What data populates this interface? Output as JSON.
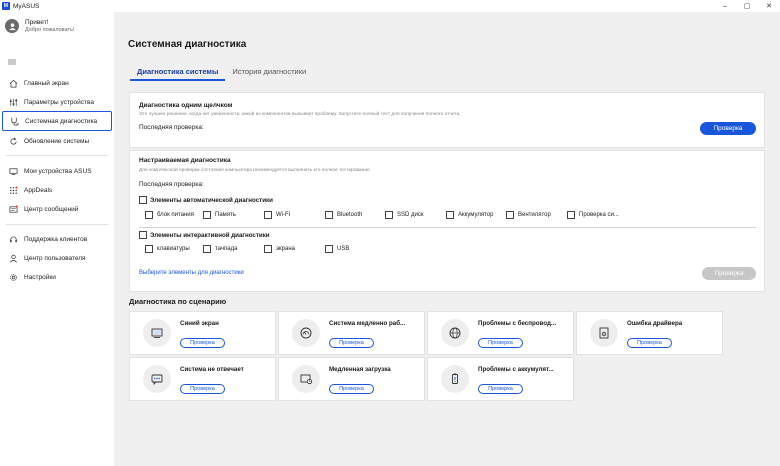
{
  "window": {
    "title": "MyASUS",
    "logo_text": "M",
    "minimize": "–",
    "maximize": "▢",
    "close": "✕"
  },
  "sidebar": {
    "greeting": "Привет!",
    "welcome": "Добро пожаловать!",
    "items": [
      {
        "label": "Главный экран",
        "icon": "home-icon"
      },
      {
        "label": "Параметры устройства",
        "icon": "settings-sliders-icon"
      },
      {
        "label": "Системная диагностика",
        "icon": "stethoscope-icon"
      },
      {
        "label": "Обновление системы",
        "icon": "refresh-icon"
      },
      {
        "label": "Мои устройства ASUS",
        "icon": "devices-icon"
      },
      {
        "label": "AppDeals",
        "icon": "grid-icon"
      },
      {
        "label": "Центр сообщений",
        "icon": "message-icon"
      },
      {
        "label": "Поддержка клиентов",
        "icon": "headset-icon"
      },
      {
        "label": "Центр пользователя",
        "icon": "user-icon"
      },
      {
        "label": "Настройки",
        "icon": "gear-icon"
      }
    ]
  },
  "main": {
    "title": "Системная диагностика",
    "tabs": [
      "Диагностика системы",
      "История диагностики"
    ]
  },
  "one_click": {
    "title": "Диагностика одним щелчком",
    "desc": "Это лучшее решение, когда нет уверенности, какой из компонентов вызывает проблему. Запустите полный тест для получения полного отчета.",
    "last_check": "Последняя проверка:",
    "button": "Проверка"
  },
  "custom": {
    "title": "Настраиваемая диагностика",
    "desc": "Для комплексной проверки состояния компьютера рекомендуется выполнить его полное тестирование.",
    "last_check": "Последняя проверка:",
    "auto_label": "Элементы автоматической диагностики",
    "auto_items": [
      "блок питания",
      "Память",
      "Wi-Fi",
      "Bluetooth",
      "SSD диск",
      "Аккумулятор",
      "Вентилятор",
      "Проверка си..."
    ],
    "interactive_label": "Элементы интерактивной диагностики",
    "interactive_items": [
      "клавиатуры",
      "тачпада",
      "экрана",
      "USB"
    ],
    "link": "Выберите элементы для диагностики",
    "button": "Проверка"
  },
  "scenarios": {
    "title": "Диагностика по сценарию",
    "button": "Проверка",
    "items": [
      {
        "name": "Синий экран",
        "icon": "monitor-icon"
      },
      {
        "name": "Система медленно раб...",
        "icon": "speedometer-icon"
      },
      {
        "name": "Проблемы с беспровод...",
        "icon": "globe-icon"
      },
      {
        "name": "Ошибка драйвера",
        "icon": "driver-gear-icon"
      },
      {
        "name": "Система не отвечает",
        "icon": "chat-dots-icon"
      },
      {
        "name": "Медленная загрузка",
        "icon": "screen-clock-icon"
      },
      {
        "name": "Проблемы с аккумулят...",
        "icon": "battery-icon"
      }
    ]
  },
  "colors": {
    "accent": "#1a56db",
    "disabled": "#c7c7c7"
  }
}
